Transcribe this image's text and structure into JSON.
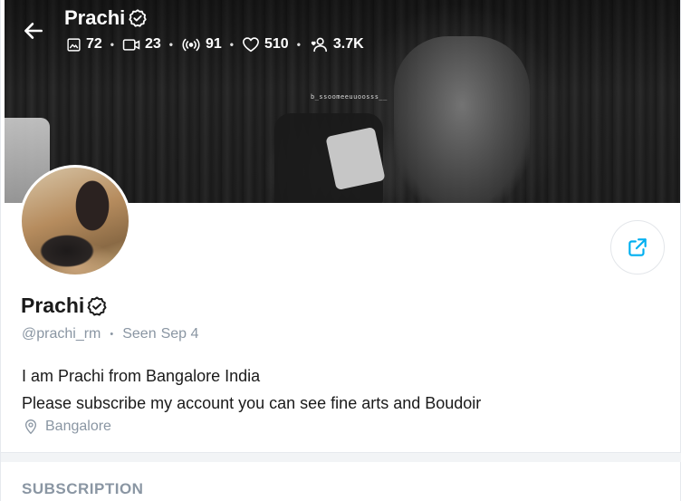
{
  "header": {
    "name": "Prachi",
    "stats": [
      {
        "icon": "image-icon",
        "value": "72"
      },
      {
        "icon": "video-icon",
        "value": "23"
      },
      {
        "icon": "broadcast-icon",
        "value": "91"
      },
      {
        "icon": "heart-icon",
        "value": "510"
      },
      {
        "icon": "fans-icon",
        "value": "3.7K"
      }
    ],
    "watermark": "b_ssoomeeuuoosss__"
  },
  "profile": {
    "name": "Prachi",
    "handle": "@prachi_rm",
    "seen_label": "Seen",
    "seen_date": "Sep 4",
    "bio_line1": "I am Prachi from Bangalore India",
    "bio_line2": "Please subscribe my account you can see fine arts and Boudoir",
    "location": "Bangalore"
  },
  "sections": {
    "subscription_title": "SUBSCRIPTION"
  },
  "colors": {
    "accent": "#00aff0",
    "muted_text": "#8a96a3",
    "primary_text": "#1a1a1a"
  }
}
